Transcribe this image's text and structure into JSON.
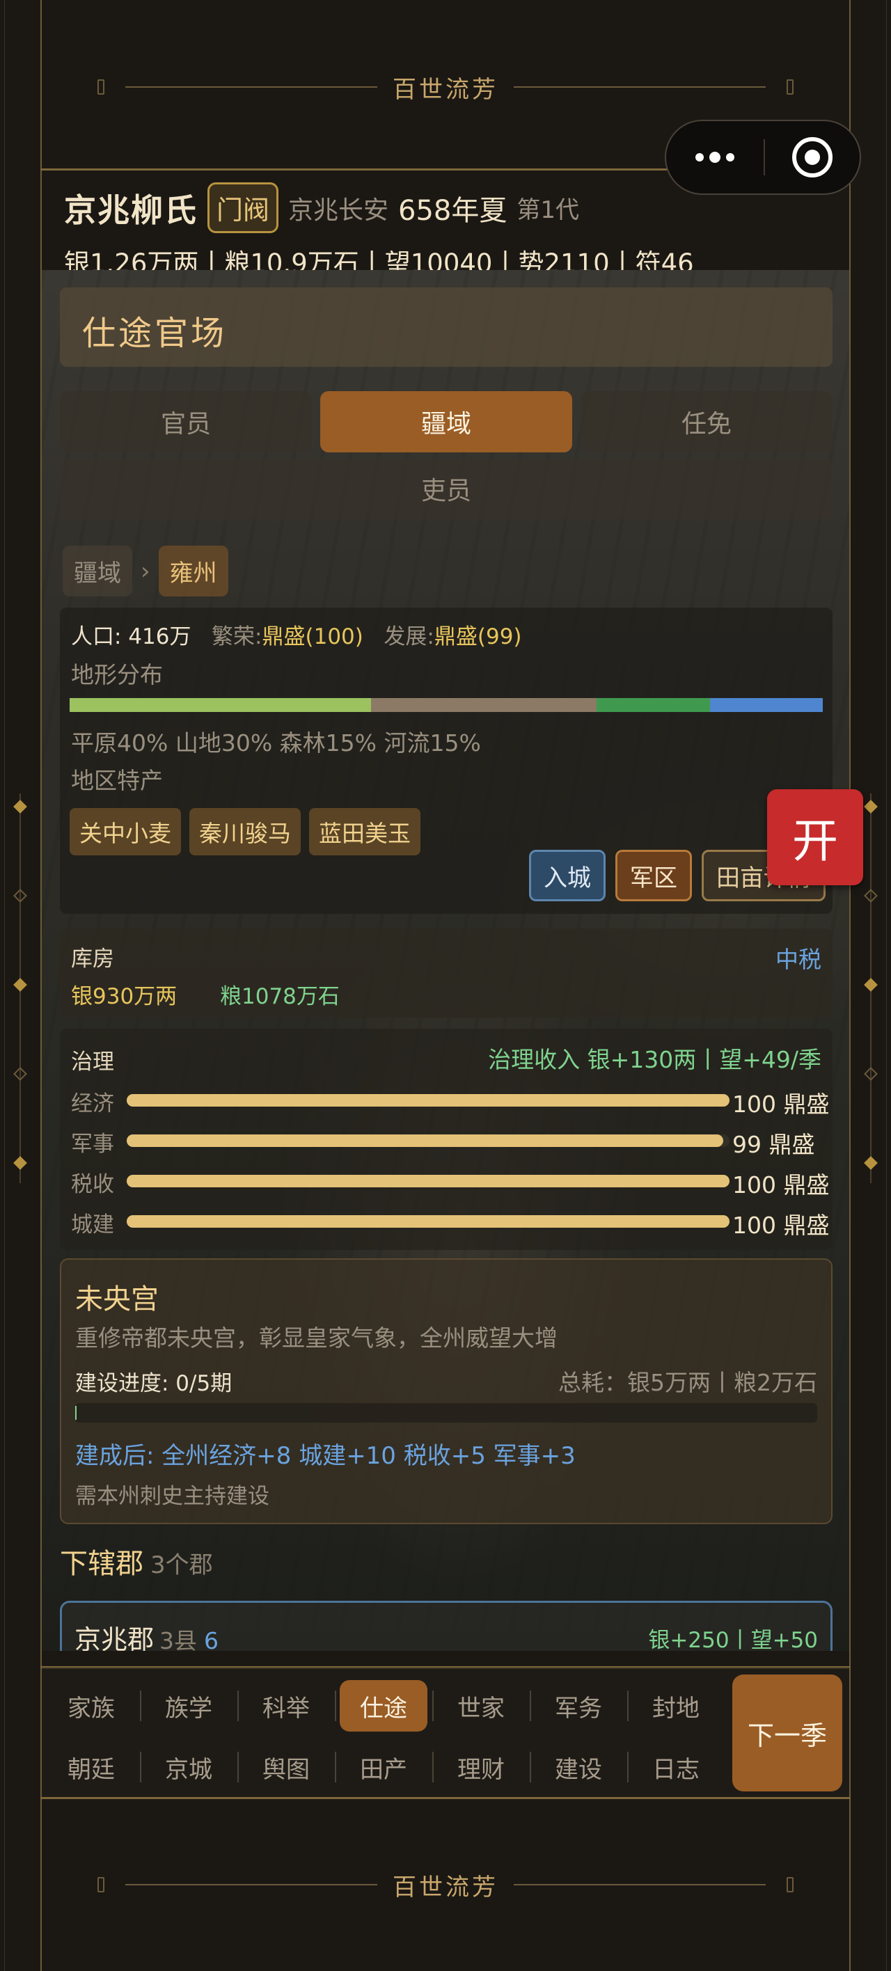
{
  "banner": {
    "title": "百世流芳"
  },
  "header": {
    "clan_name": "京兆柳氏",
    "rank_tag": "门阀",
    "location": "京兆长安",
    "year": "658年夏",
    "generation": "第1代",
    "resources": "银1.26万两丨粮10.9万石丨望10040丨势2110丨符46"
  },
  "section": {
    "title": "仕途官场"
  },
  "tabs": [
    {
      "label": "官员"
    },
    {
      "label": "疆域"
    },
    {
      "label": "任免"
    },
    {
      "label": "吏员"
    }
  ],
  "breadcrumb": {
    "root": "疆域",
    "arrow": "›",
    "current": "雍州"
  },
  "region": {
    "population_label": "人口:",
    "population": "416万",
    "prosperity_label": "繁荣:",
    "prosperity": "鼎盛(100)",
    "development_label": "发展:",
    "development": "鼎盛(99)",
    "terrain_heading": "地形分布",
    "terrain": [
      {
        "name": "平原",
        "percent": 40,
        "color": "#9bc25f"
      },
      {
        "name": "山地",
        "percent": 30,
        "color": "#8c7a66"
      },
      {
        "name": "森林",
        "percent": 15,
        "color": "#3f9a4f"
      },
      {
        "name": "河流",
        "percent": 15,
        "color": "#4f86cf"
      }
    ],
    "terrain_text": "平原40% 山地30% 森林15% 河流15%",
    "specialty_heading": "地区特产",
    "specialties": [
      "关中小麦",
      "秦川骏马",
      "蓝田美玉"
    ],
    "actions": {
      "enter_city": "入城",
      "military": "军区",
      "farmland": "田亩详情"
    }
  },
  "floating_button": {
    "label": "开"
  },
  "treasury": {
    "title": "库房",
    "tax_level": "中税",
    "silver": "银930万两",
    "grain": "粮1078万石"
  },
  "governance": {
    "title": "治理",
    "income": "治理收入 银+130两丨望+49/季",
    "items": [
      {
        "label": "经济",
        "value": 100,
        "text": "100 鼎盛"
      },
      {
        "label": "军事",
        "value": 99,
        "text": "99 鼎盛"
      },
      {
        "label": "税收",
        "value": 100,
        "text": "100 鼎盛"
      },
      {
        "label": "城建",
        "value": 100,
        "text": "100 鼎盛"
      }
    ]
  },
  "project": {
    "title": "未央宫",
    "description": "重修帝都未央宫，彰显皇家气象，全州威望大增",
    "progress_label": "建设进度: 0/5期",
    "progress": 0,
    "cost": "总耗：银5万两丨粮2万石",
    "effect": "建成后: 全州经济+8 城建+10 税收+5 军事+3",
    "requirement": "需本州刺史主持建设"
  },
  "subordinate": {
    "title": "下辖郡",
    "count": "3个郡"
  },
  "commandery": {
    "name": "京兆郡",
    "counties": "3县",
    "badge": "6",
    "gain": "银+250丨望+50"
  },
  "nav": {
    "row1": [
      "家族",
      "族学",
      "科举",
      "仕途",
      "世家",
      "军务",
      "封地"
    ],
    "row2": [
      "朝廷",
      "京城",
      "舆图",
      "田产",
      "理财",
      "建设",
      "日志"
    ],
    "next": "下一季"
  },
  "colors": {
    "accent": "#9a5d25",
    "gold": "#e4c277",
    "blue": "#6aa3df",
    "green": "#7fd38e",
    "red": "#c72b2b"
  }
}
